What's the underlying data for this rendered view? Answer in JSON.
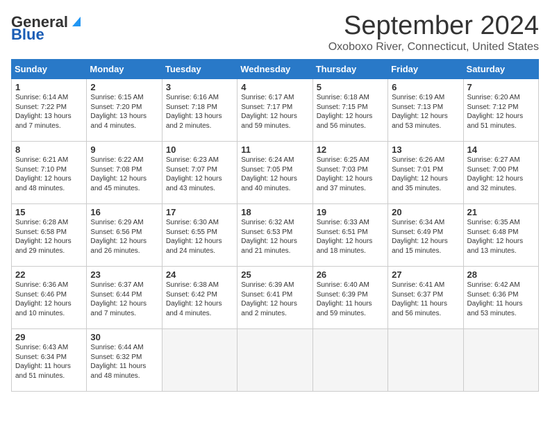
{
  "header": {
    "logo_general": "General",
    "logo_blue": "Blue",
    "month_title": "September 2024",
    "location": "Oxoboxo River, Connecticut, United States"
  },
  "days_of_week": [
    "Sunday",
    "Monday",
    "Tuesday",
    "Wednesday",
    "Thursday",
    "Friday",
    "Saturday"
  ],
  "weeks": [
    [
      {
        "day": "1",
        "info": "Sunrise: 6:14 AM\nSunset: 7:22 PM\nDaylight: 13 hours\nand 7 minutes."
      },
      {
        "day": "2",
        "info": "Sunrise: 6:15 AM\nSunset: 7:20 PM\nDaylight: 13 hours\nand 4 minutes."
      },
      {
        "day": "3",
        "info": "Sunrise: 6:16 AM\nSunset: 7:18 PM\nDaylight: 13 hours\nand 2 minutes."
      },
      {
        "day": "4",
        "info": "Sunrise: 6:17 AM\nSunset: 7:17 PM\nDaylight: 12 hours\nand 59 minutes."
      },
      {
        "day": "5",
        "info": "Sunrise: 6:18 AM\nSunset: 7:15 PM\nDaylight: 12 hours\nand 56 minutes."
      },
      {
        "day": "6",
        "info": "Sunrise: 6:19 AM\nSunset: 7:13 PM\nDaylight: 12 hours\nand 53 minutes."
      },
      {
        "day": "7",
        "info": "Sunrise: 6:20 AM\nSunset: 7:12 PM\nDaylight: 12 hours\nand 51 minutes."
      }
    ],
    [
      {
        "day": "8",
        "info": "Sunrise: 6:21 AM\nSunset: 7:10 PM\nDaylight: 12 hours\nand 48 minutes."
      },
      {
        "day": "9",
        "info": "Sunrise: 6:22 AM\nSunset: 7:08 PM\nDaylight: 12 hours\nand 45 minutes."
      },
      {
        "day": "10",
        "info": "Sunrise: 6:23 AM\nSunset: 7:07 PM\nDaylight: 12 hours\nand 43 minutes."
      },
      {
        "day": "11",
        "info": "Sunrise: 6:24 AM\nSunset: 7:05 PM\nDaylight: 12 hours\nand 40 minutes."
      },
      {
        "day": "12",
        "info": "Sunrise: 6:25 AM\nSunset: 7:03 PM\nDaylight: 12 hours\nand 37 minutes."
      },
      {
        "day": "13",
        "info": "Sunrise: 6:26 AM\nSunset: 7:01 PM\nDaylight: 12 hours\nand 35 minutes."
      },
      {
        "day": "14",
        "info": "Sunrise: 6:27 AM\nSunset: 7:00 PM\nDaylight: 12 hours\nand 32 minutes."
      }
    ],
    [
      {
        "day": "15",
        "info": "Sunrise: 6:28 AM\nSunset: 6:58 PM\nDaylight: 12 hours\nand 29 minutes."
      },
      {
        "day": "16",
        "info": "Sunrise: 6:29 AM\nSunset: 6:56 PM\nDaylight: 12 hours\nand 26 minutes."
      },
      {
        "day": "17",
        "info": "Sunrise: 6:30 AM\nSunset: 6:55 PM\nDaylight: 12 hours\nand 24 minutes."
      },
      {
        "day": "18",
        "info": "Sunrise: 6:32 AM\nSunset: 6:53 PM\nDaylight: 12 hours\nand 21 minutes."
      },
      {
        "day": "19",
        "info": "Sunrise: 6:33 AM\nSunset: 6:51 PM\nDaylight: 12 hours\nand 18 minutes."
      },
      {
        "day": "20",
        "info": "Sunrise: 6:34 AM\nSunset: 6:49 PM\nDaylight: 12 hours\nand 15 minutes."
      },
      {
        "day": "21",
        "info": "Sunrise: 6:35 AM\nSunset: 6:48 PM\nDaylight: 12 hours\nand 13 minutes."
      }
    ],
    [
      {
        "day": "22",
        "info": "Sunrise: 6:36 AM\nSunset: 6:46 PM\nDaylight: 12 hours\nand 10 minutes."
      },
      {
        "day": "23",
        "info": "Sunrise: 6:37 AM\nSunset: 6:44 PM\nDaylight: 12 hours\nand 7 minutes."
      },
      {
        "day": "24",
        "info": "Sunrise: 6:38 AM\nSunset: 6:42 PM\nDaylight: 12 hours\nand 4 minutes."
      },
      {
        "day": "25",
        "info": "Sunrise: 6:39 AM\nSunset: 6:41 PM\nDaylight: 12 hours\nand 2 minutes."
      },
      {
        "day": "26",
        "info": "Sunrise: 6:40 AM\nSunset: 6:39 PM\nDaylight: 11 hours\nand 59 minutes."
      },
      {
        "day": "27",
        "info": "Sunrise: 6:41 AM\nSunset: 6:37 PM\nDaylight: 11 hours\nand 56 minutes."
      },
      {
        "day": "28",
        "info": "Sunrise: 6:42 AM\nSunset: 6:36 PM\nDaylight: 11 hours\nand 53 minutes."
      }
    ],
    [
      {
        "day": "29",
        "info": "Sunrise: 6:43 AM\nSunset: 6:34 PM\nDaylight: 11 hours\nand 51 minutes."
      },
      {
        "day": "30",
        "info": "Sunrise: 6:44 AM\nSunset: 6:32 PM\nDaylight: 11 hours\nand 48 minutes."
      },
      {
        "day": "",
        "info": ""
      },
      {
        "day": "",
        "info": ""
      },
      {
        "day": "",
        "info": ""
      },
      {
        "day": "",
        "info": ""
      },
      {
        "day": "",
        "info": ""
      }
    ]
  ]
}
